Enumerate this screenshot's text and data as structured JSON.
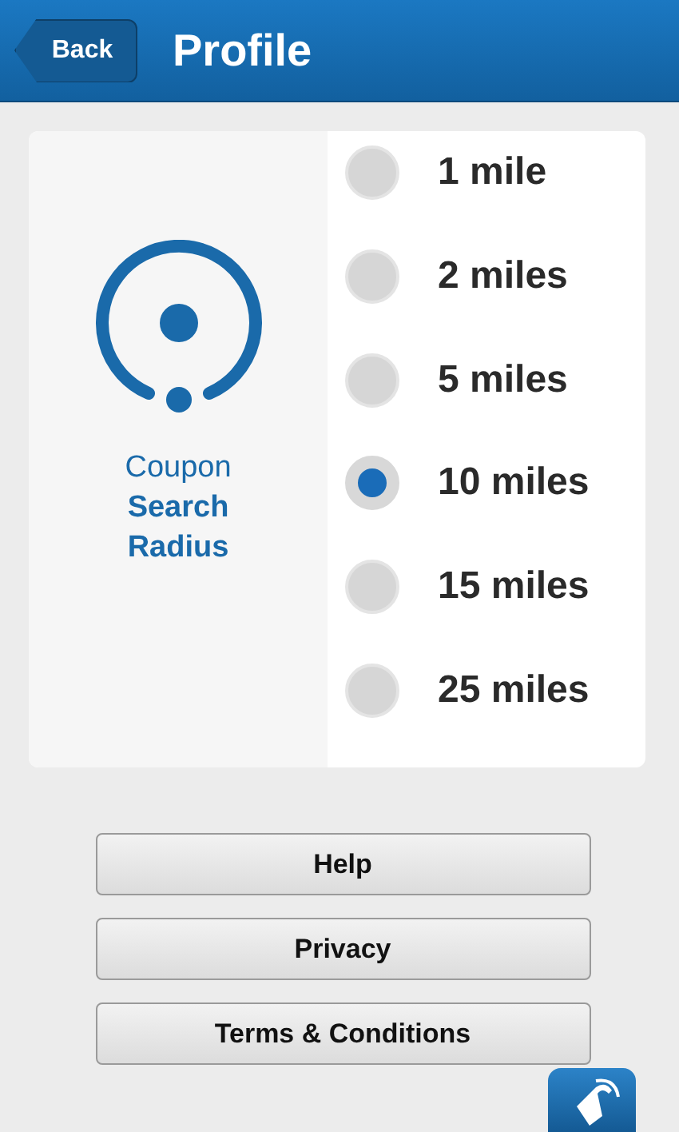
{
  "header": {
    "back": "Back",
    "title": "Profile"
  },
  "radius_panel": {
    "label": "Coupon **Search Radius**"
  },
  "options": [
    {
      "label": "1 mile",
      "selected": false
    },
    {
      "label": "2 miles",
      "selected": false
    },
    {
      "label": "5 miles",
      "selected": false
    },
    {
      "label": "10 miles",
      "selected": true
    },
    {
      "label": "15 miles",
      "selected": false
    },
    {
      "label": "25 miles",
      "selected": false
    }
  ],
  "buttons": [
    "Help",
    "Privacy",
    "Terms & Conditions"
  ]
}
